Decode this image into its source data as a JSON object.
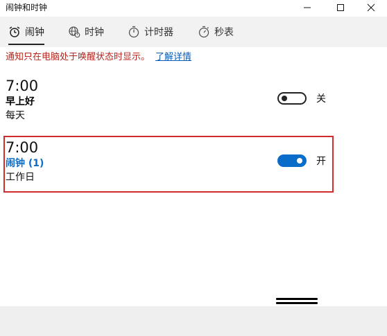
{
  "window": {
    "title": "闹钟和时钟"
  },
  "tabs": [
    {
      "label": "闹钟",
      "icon": "alarm-clock-icon",
      "active": true
    },
    {
      "label": "时钟",
      "icon": "world-clock-icon",
      "active": false
    },
    {
      "label": "计时器",
      "icon": "timer-icon",
      "active": false
    },
    {
      "label": "秒表",
      "icon": "stopwatch-icon",
      "active": false
    }
  ],
  "notice": {
    "text": "通知只在电脑处于唤醒状态时显示。",
    "link": "了解详情"
  },
  "alarms": [
    {
      "time": "7:00",
      "name": "早上好",
      "days": "每天",
      "state_label": "关",
      "on": false
    },
    {
      "time": "7:00",
      "name": "闹钟 (1)",
      "days": "工作日",
      "state_label": "开",
      "on": true
    }
  ],
  "colors": {
    "accent": "#0a6cc9",
    "notice_red": "#b3261e",
    "highlight_box": "#d12b2b",
    "link": "#0a5db6"
  }
}
